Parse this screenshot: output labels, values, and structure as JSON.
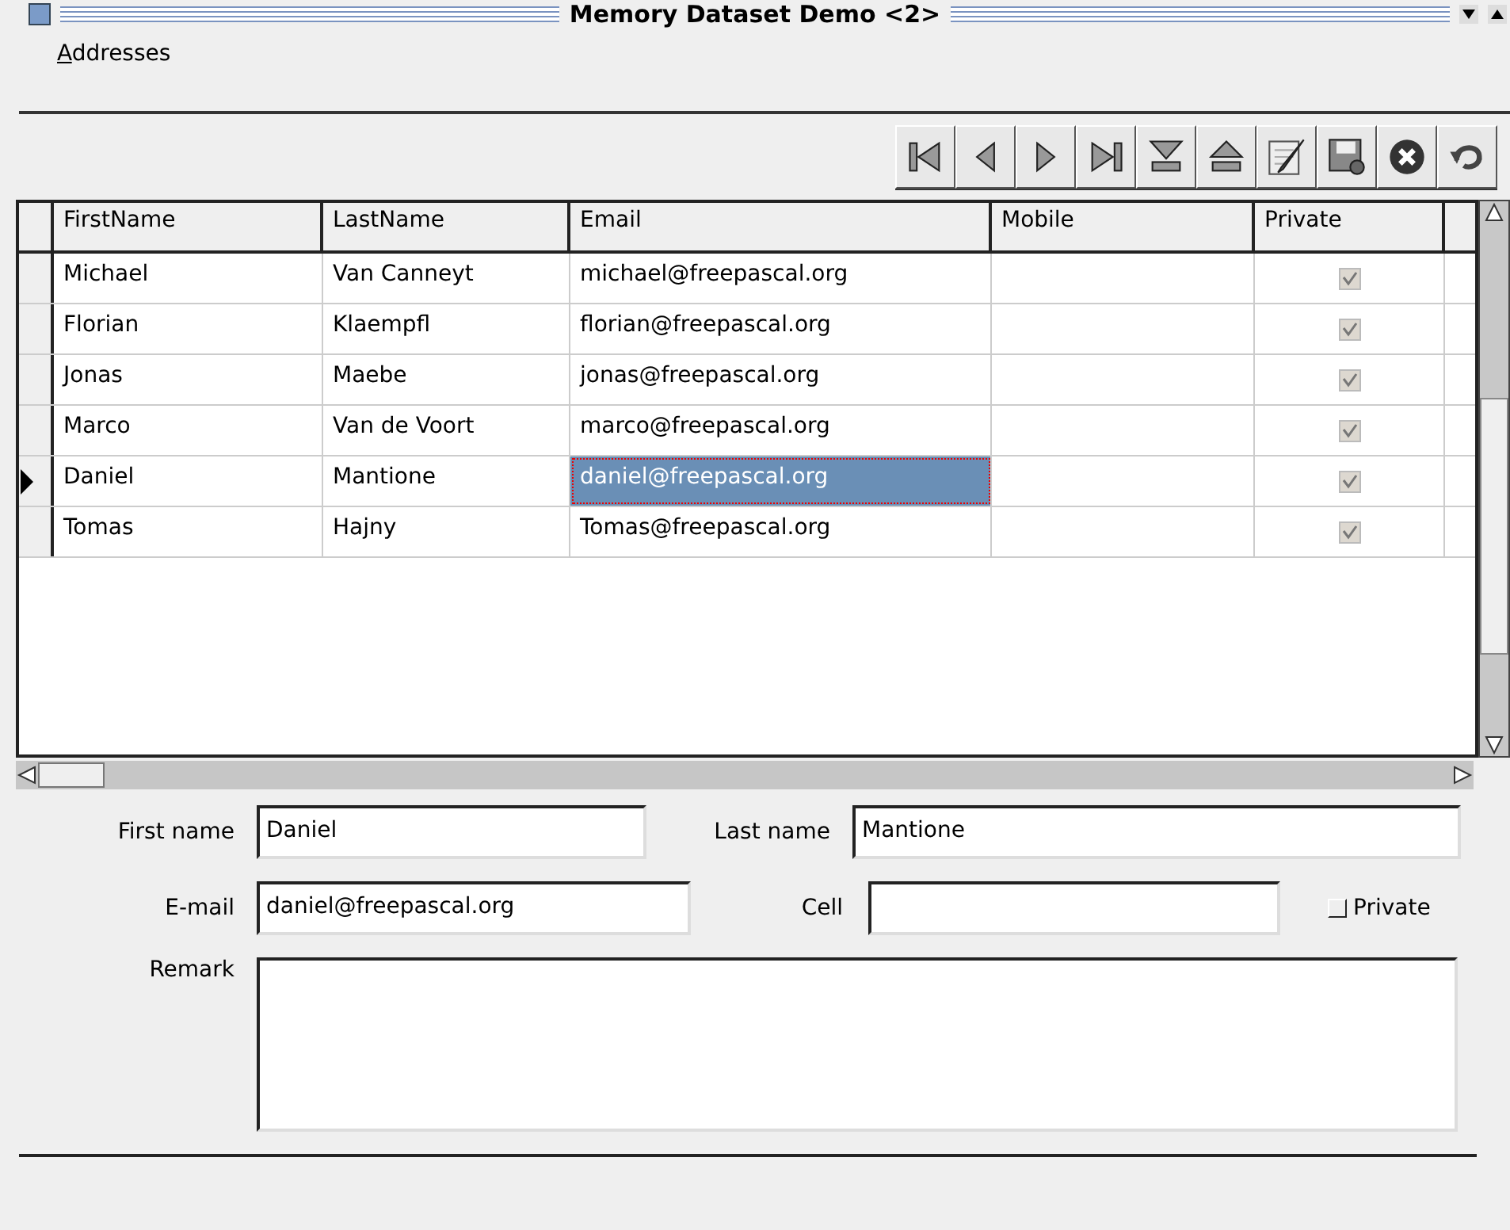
{
  "window": {
    "title": "Memory Dataset Demo <2>"
  },
  "menu": [
    {
      "label": "Addresses"
    }
  ],
  "toolbar": [
    {
      "kind": "first"
    },
    {
      "kind": "prior"
    },
    {
      "kind": "next"
    },
    {
      "kind": "last"
    },
    {
      "kind": "insert"
    },
    {
      "kind": "delete"
    },
    {
      "kind": "edit"
    },
    {
      "kind": "post"
    },
    {
      "kind": "cancel"
    },
    {
      "kind": "refresh"
    }
  ],
  "grid": {
    "columns": [
      "FirstName",
      "LastName",
      "Email",
      "Mobile",
      "Private"
    ],
    "rows": [
      {
        "first": "Michael",
        "last": "Van Canneyt",
        "email": "michael@freepascal.org",
        "mobile": "",
        "private": true,
        "selected": false
      },
      {
        "first": "Florian",
        "last": "Klaempfl",
        "email": "florian@freepascal.org",
        "mobile": "",
        "private": true,
        "selected": false
      },
      {
        "first": "Jonas",
        "last": "Maebe",
        "email": "jonas@freepascal.org",
        "mobile": "",
        "private": true,
        "selected": false
      },
      {
        "first": "Marco",
        "last": "Van de Voort",
        "email": "marco@freepascal.org",
        "mobile": "",
        "private": true,
        "selected": false
      },
      {
        "first": "Daniel",
        "last": "Mantione",
        "email": "daniel@freepascal.org",
        "mobile": "",
        "private": true,
        "selected": true
      },
      {
        "first": "Tomas",
        "last": "Hajny",
        "email": "Tomas@freepascal.org",
        "mobile": "",
        "private": true,
        "selected": false
      }
    ]
  },
  "form": {
    "first_name": {
      "label": "First name",
      "value": "Daniel"
    },
    "last_name": {
      "label": "Last name",
      "value": "Mantione"
    },
    "email": {
      "label": "E-mail",
      "value": "daniel@freepascal.org"
    },
    "cell": {
      "label": "Cell"
    },
    "private": {
      "label": "Private",
      "checked": false
    },
    "remark": {
      "label": "Remark"
    }
  }
}
